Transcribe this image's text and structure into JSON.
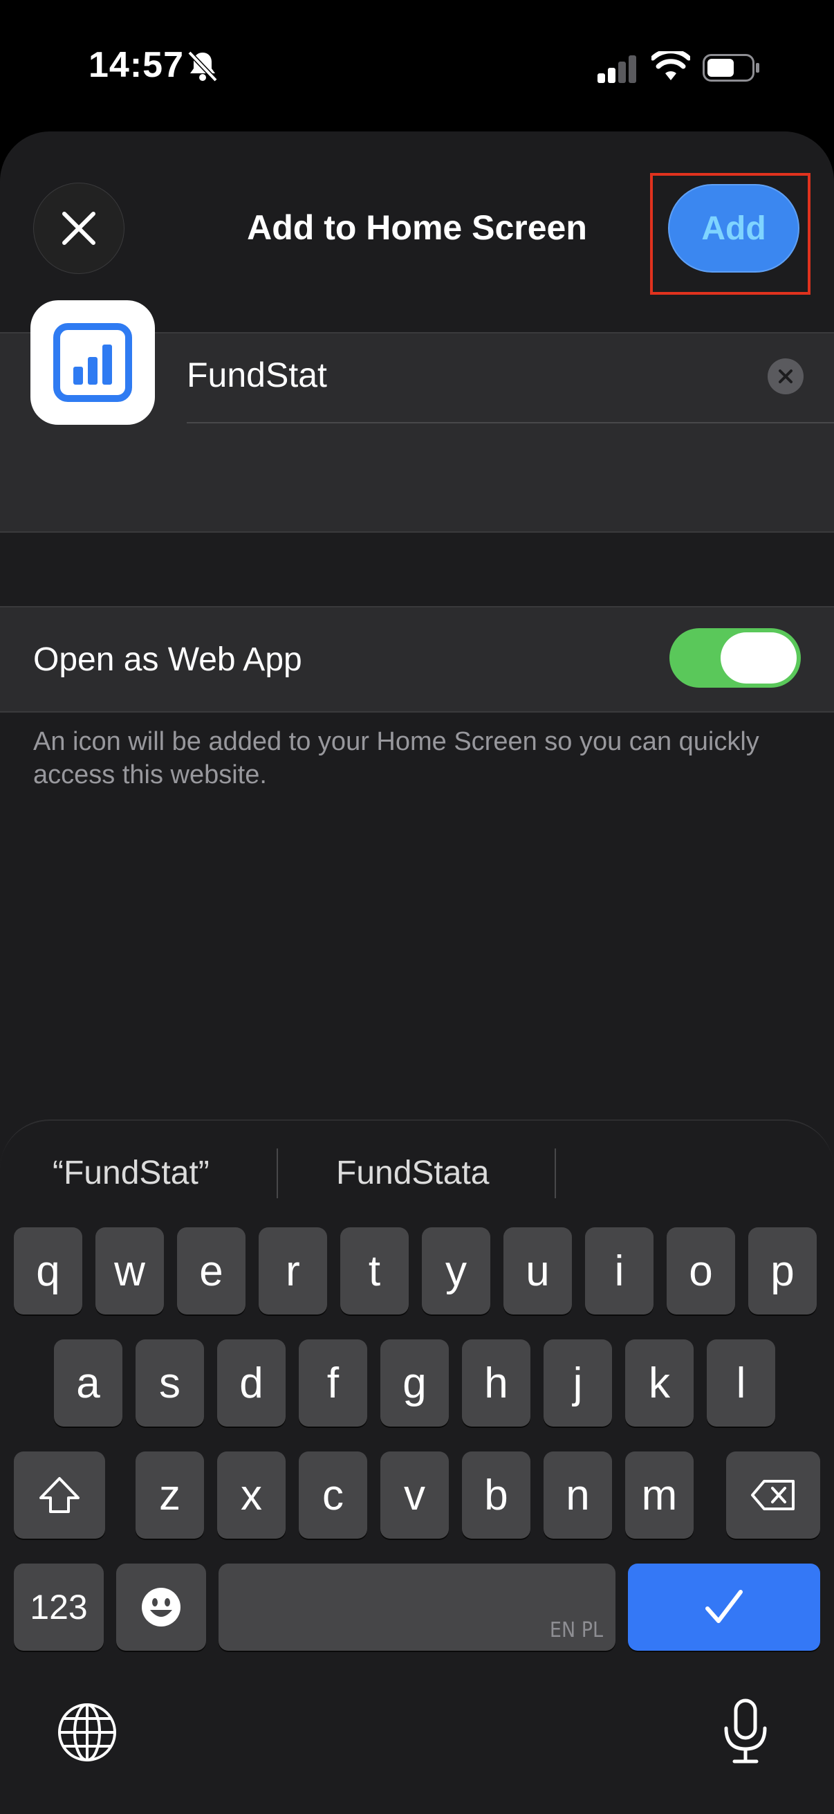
{
  "status_bar": {
    "time": "14:57"
  },
  "sheet": {
    "title": "Add to Home Screen",
    "add_label": "Add"
  },
  "name_field": {
    "value": "FundStat"
  },
  "web_app": {
    "label": "Open as Web App",
    "enabled": true,
    "footnote": "An icon will be added to your Home Screen so you can quickly access this website."
  },
  "keyboard": {
    "suggestions": [
      "“FundStat”",
      "FundStata",
      ""
    ],
    "row1": [
      "q",
      "w",
      "e",
      "r",
      "t",
      "y",
      "u",
      "i",
      "o",
      "p"
    ],
    "row2": [
      "a",
      "s",
      "d",
      "f",
      "g",
      "h",
      "j",
      "k",
      "l"
    ],
    "row3": [
      "z",
      "x",
      "c",
      "v",
      "b",
      "n",
      "m"
    ],
    "numbers_label": "123",
    "language_label": "EN PL"
  },
  "colors": {
    "accent": "#3b87f0",
    "toggle_on": "#5ac85a",
    "highlight": "#e0321e"
  }
}
